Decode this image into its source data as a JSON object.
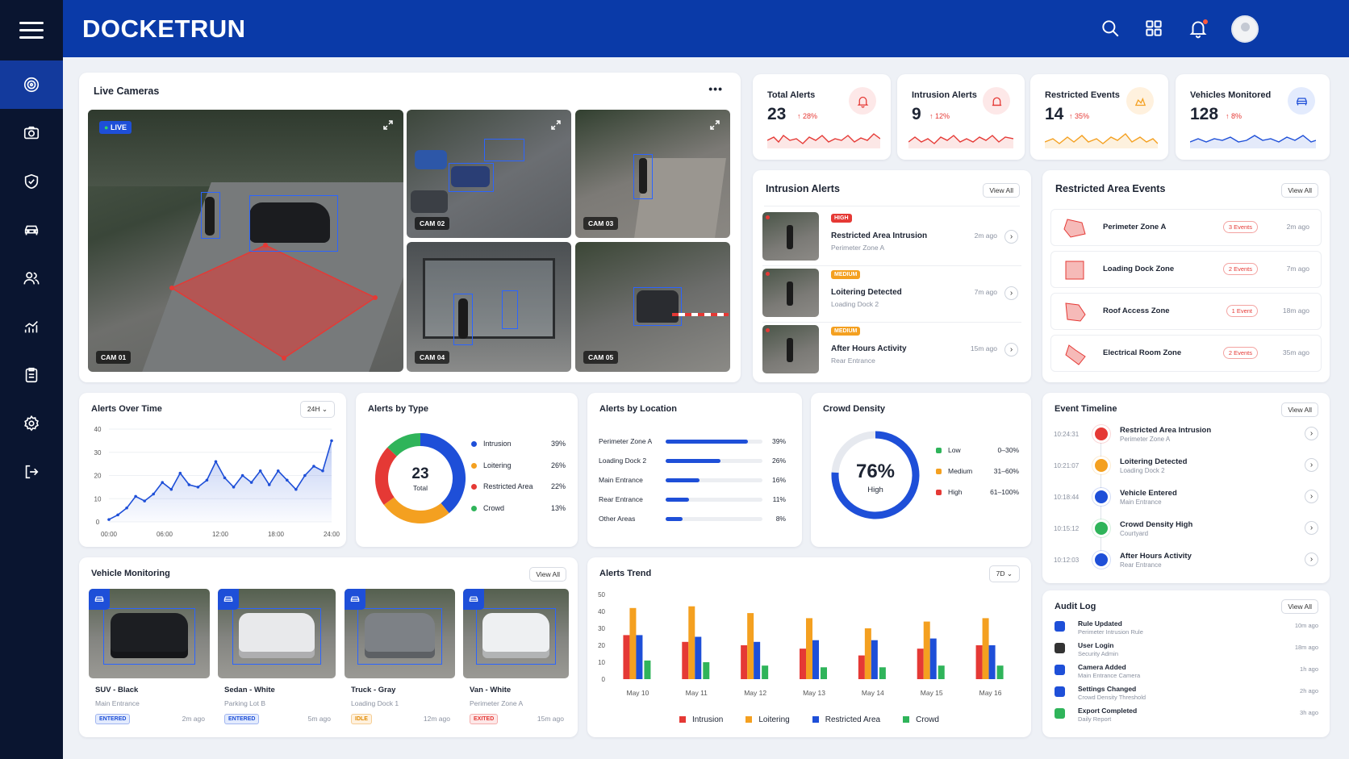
{
  "app": {
    "logo": "DOCKETRUN"
  },
  "colors": {
    "primary": "#0a3aa8",
    "sidebar": "#0a1530",
    "red": "#e53935",
    "orange": "#f4a020",
    "blue": "#1e4fd8",
    "green": "#2fb45a"
  },
  "sidebar": {
    "items": [
      {
        "icon": "radar-icon",
        "active": true
      },
      {
        "icon": "camera-icon"
      },
      {
        "icon": "shield-icon"
      },
      {
        "icon": "car-icon"
      },
      {
        "icon": "users-icon"
      },
      {
        "icon": "analytics-icon"
      },
      {
        "icon": "clipboard-icon"
      },
      {
        "icon": "settings-icon"
      },
      {
        "icon": "logout-icon"
      }
    ]
  },
  "live": {
    "title": "Live Cameras",
    "more": "•••",
    "live_badge": "LIVE",
    "cams": [
      "CAM 01",
      "CAM 02",
      "CAM 03",
      "CAM 04",
      "CAM 05"
    ]
  },
  "stats": [
    {
      "label": "Total Alerts",
      "value": "23",
      "pct": "↑ 28%",
      "icon": "bell-icon"
    },
    {
      "label": "Intrusion Alerts",
      "value": "9",
      "pct": "↑ 12%",
      "icon": "alarm-icon"
    },
    {
      "label": "Restricted Events",
      "value": "14",
      "pct": "↑ 35%",
      "icon": "restricted-icon"
    },
    {
      "label": "Vehicles Monitored",
      "value": "128",
      "pct": "↑ 8%",
      "icon": "car-icon"
    }
  ],
  "intrusion": {
    "title": "Intrusion Alerts",
    "view_all": "View All",
    "items": [
      {
        "severity": "HIGH",
        "title": "Restricted Area Intrusion",
        "location": "Perimeter Zone A",
        "time": "2m ago"
      },
      {
        "severity": "MEDIUM",
        "title": "Loitering Detected",
        "location": "Loading Dock 2",
        "time": "7m ago"
      },
      {
        "severity": "MEDIUM",
        "title": "After Hours Activity",
        "location": "Rear Entrance",
        "time": "15m ago"
      }
    ]
  },
  "restricted": {
    "title": "Restricted Area Events",
    "view_all": "View All",
    "items": [
      {
        "zone": "Perimeter Zone A",
        "events": "3 Events",
        "time": "2m ago"
      },
      {
        "zone": "Loading Dock Zone",
        "events": "2 Events",
        "time": "7m ago"
      },
      {
        "zone": "Roof Access Zone",
        "events": "1 Event",
        "time": "18m ago"
      },
      {
        "zone": "Electrical Room Zone",
        "events": "2 Events",
        "time": "35m ago"
      }
    ]
  },
  "alerts_over_time": {
    "title": "Alerts Over Time",
    "range": "24H"
  },
  "alerts_by_type": {
    "title": "Alerts by Type",
    "total": "23",
    "total_label": "Total"
  },
  "alerts_by_location": {
    "title": "Alerts by Location",
    "rows": [
      {
        "name": "Perimeter Zone A",
        "value": 39,
        "label": "39%"
      },
      {
        "name": "Loading Dock 2",
        "value": 26,
        "label": "26%"
      },
      {
        "name": "Main Entrance",
        "value": 16,
        "label": "16%"
      },
      {
        "name": "Rear Entrance",
        "value": 11,
        "label": "11%"
      },
      {
        "name": "Other Areas",
        "value": 8,
        "label": "8%"
      }
    ]
  },
  "crowd": {
    "title": "Crowd Density",
    "value": "76%",
    "level": "High",
    "fraction": 0.76,
    "legend": [
      {
        "name": "Low",
        "range": "0–30%",
        "color": "#2fb45a"
      },
      {
        "name": "Medium",
        "range": "31–60%",
        "color": "#f4a020"
      },
      {
        "name": "High",
        "range": "61–100%",
        "color": "#e53935"
      }
    ]
  },
  "timeline": {
    "title": "Event Timeline",
    "view_all": "View All",
    "items": [
      {
        "time": "10:24:31",
        "title": "Restricted Area Intrusion",
        "sub": "Perimeter Zone A",
        "color": "#e53935"
      },
      {
        "time": "10:21:07",
        "title": "Loitering Detected",
        "sub": "Loading Dock 2",
        "color": "#f4a020"
      },
      {
        "time": "10:18:44",
        "title": "Vehicle Entered",
        "sub": "Main Entrance",
        "color": "#1e4fd8"
      },
      {
        "time": "10:15:12",
        "title": "Crowd Density High",
        "sub": "Courtyard",
        "color": "#2fb45a"
      },
      {
        "time": "10:12:03",
        "title": "After Hours Activity",
        "sub": "Rear Entrance",
        "color": "#1e4fd8"
      }
    ]
  },
  "vehicles": {
    "title": "Vehicle Monitoring",
    "view_all": "View All",
    "items": [
      {
        "name": "SUV - Black",
        "loc": "Main Entrance",
        "status": "ENTERED",
        "time": "2m ago"
      },
      {
        "name": "Sedan - White",
        "loc": "Parking Lot B",
        "status": "ENTERED",
        "time": "5m ago"
      },
      {
        "name": "Truck - Gray",
        "loc": "Loading Dock 1",
        "status": "IDLE",
        "time": "12m ago"
      },
      {
        "name": "Van - White",
        "loc": "Perimeter Zone A",
        "status": "EXITED",
        "time": "15m ago"
      }
    ]
  },
  "alerts_trend": {
    "title": "Alerts Trend",
    "range": "7D"
  },
  "audit": {
    "title": "Audit Log",
    "view_all": "View All",
    "items": [
      {
        "title": "Rule Updated",
        "sub": "Perimeter Intrusion Rule",
        "time": "10m ago"
      },
      {
        "title": "User Login",
        "sub": "Security Admin",
        "time": "18m ago"
      },
      {
        "title": "Camera Added",
        "sub": "Main Entrance Camera",
        "time": "1h ago"
      },
      {
        "title": "Settings Changed",
        "sub": "Crowd Density Threshold",
        "time": "2h ago"
      },
      {
        "title": "Export Completed",
        "sub": "Daily Report",
        "time": "3h ago"
      }
    ]
  },
  "chart_data": [
    {
      "type": "line",
      "title": "Alerts Over Time",
      "categories": [
        "00:00",
        "06:00",
        "12:00",
        "18:00",
        "24:00"
      ],
      "yticks": [
        0,
        10,
        20,
        30,
        40
      ],
      "ylim": [
        0,
        40
      ],
      "series": [
        {
          "values": [
            1,
            3,
            6,
            11,
            9,
            12,
            17,
            14,
            21,
            16,
            15,
            18,
            26,
            19,
            15,
            20,
            17,
            22,
            16,
            22,
            18,
            14,
            20,
            24,
            22,
            35
          ]
        }
      ]
    },
    {
      "type": "pie",
      "title": "Alerts by Type",
      "slices": [
        {
          "name": "Intrusion",
          "value": 39,
          "label": "39%",
          "color": "#1e4fd8"
        },
        {
          "name": "Loitering",
          "value": 26,
          "label": "26%",
          "color": "#f4a020"
        },
        {
          "name": "Restricted Area",
          "value": 22,
          "label": "22%",
          "color": "#e53935"
        },
        {
          "name": "Crowd",
          "value": 13,
          "label": "13%",
          "color": "#2fb45a"
        }
      ]
    },
    {
      "type": "bar",
      "title": "Alerts Trend",
      "categories": [
        "May 10",
        "May 11",
        "May 12",
        "May 13",
        "May 14",
        "May 15",
        "May 16"
      ],
      "yticks": [
        0,
        10,
        20,
        30,
        40,
        50
      ],
      "ylim": [
        0,
        50
      ],
      "series": [
        {
          "name": "Intrusion",
          "color": "#e53935",
          "values": [
            26,
            22,
            20,
            18,
            14,
            18,
            20
          ]
        },
        {
          "name": "Loitering",
          "color": "#f4a020",
          "values": [
            42,
            43,
            39,
            36,
            30,
            34,
            36
          ]
        },
        {
          "name": "Restricted Area",
          "color": "#1e4fd8",
          "values": [
            26,
            25,
            22,
            23,
            23,
            24,
            20
          ]
        },
        {
          "name": "Crowd",
          "color": "#2fb45a",
          "values": [
            11,
            10,
            8,
            7,
            7,
            8,
            8
          ]
        }
      ]
    }
  ]
}
